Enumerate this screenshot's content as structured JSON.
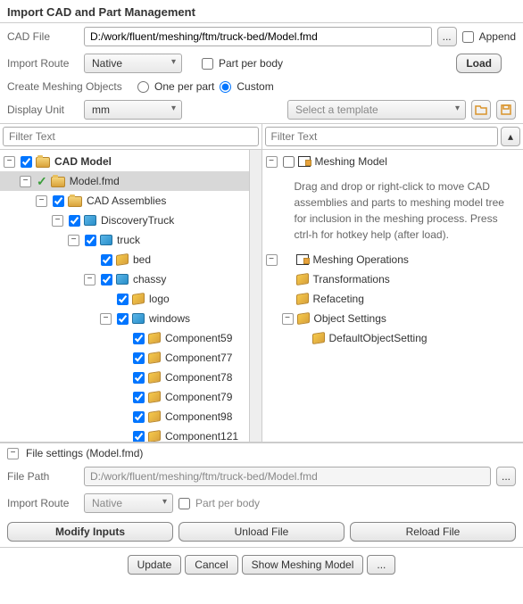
{
  "title": "Import CAD and Part Management",
  "cadFile": {
    "label": "CAD File",
    "value": "D:/work/fluent/meshing/ftm/truck-bed/Model.fmd",
    "browse": "...",
    "appendLabel": "Append"
  },
  "importRoute": {
    "label": "Import Route",
    "value": "Native",
    "partPerBody": "Part per body",
    "loadLabel": "Load"
  },
  "meshObjects": {
    "label": "Create Meshing Objects",
    "opt1": "One per part",
    "opt2": "Custom"
  },
  "displayUnit": {
    "label": "Display Unit",
    "value": "mm",
    "templatePlaceholder": "Select a template"
  },
  "filterPlaceholder": "Filter Text",
  "leftTree": {
    "root": "CAD Model",
    "model": "Model.fmd",
    "assemblies": "CAD Assemblies",
    "items": [
      "DiscoveryTruck",
      "truck",
      "bed",
      "chassy",
      "logo",
      "windows",
      "Component59",
      "Component77",
      "Component78",
      "Component79",
      "Component98",
      "Component121"
    ]
  },
  "rightTree": {
    "root": "Meshing Model",
    "hint": "Drag and drop or right-click to move CAD assemblies and parts to meshing model tree for inclusion in the meshing process. Press ctrl-h for hotkey help (after load).",
    "ops": "Meshing Operations",
    "opsItems": [
      "Transformations",
      "Refaceting",
      "Object Settings",
      "DefaultObjectSetting"
    ]
  },
  "fileSettings": {
    "title": "File settings (Model.fmd)",
    "pathLabel": "File Path",
    "pathValue": "D:/work/fluent/meshing/ftm/truck-bed/Model.fmd",
    "browse": "...",
    "routeLabel": "Import Route",
    "routeValue": "Native",
    "partPerBody": "Part per body",
    "modify": "Modify Inputs",
    "unload": "Unload File",
    "reload": "Reload File"
  },
  "footer": {
    "update": "Update",
    "cancel": "Cancel",
    "show": "Show Meshing Model",
    "more": "..."
  }
}
